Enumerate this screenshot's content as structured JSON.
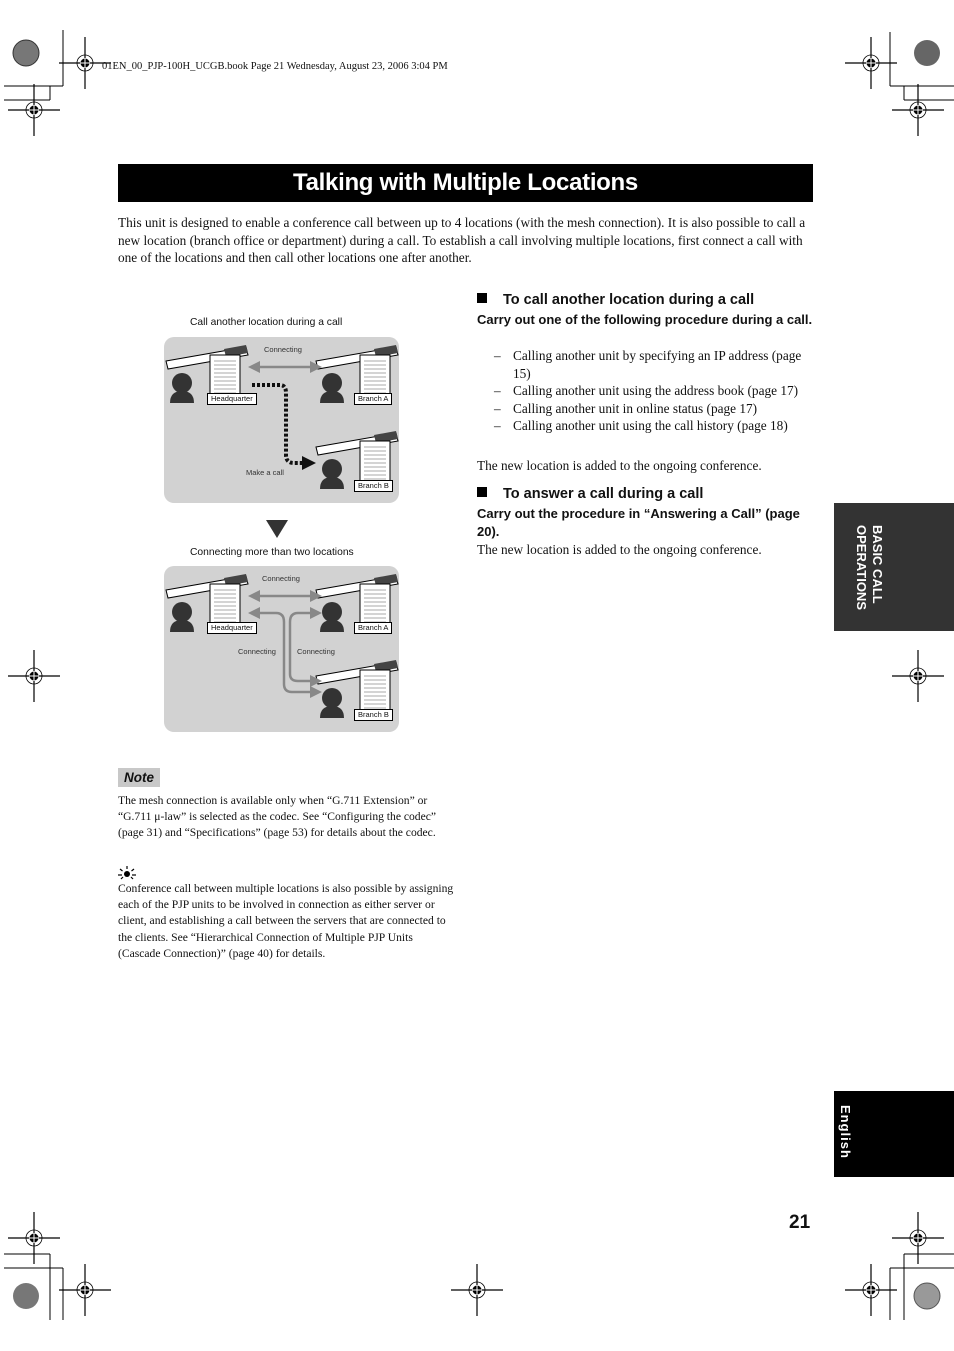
{
  "header": {
    "print_line": "01EN_00_PJP-100H_UCGB.book  Page 21  Wednesday, August 23, 2006  3:04 PM"
  },
  "title": "Talking with Multiple Locations",
  "intro": "This unit is designed to enable a conference call between up to 4 locations (with the mesh connection). It is also possible to call a new location (branch office or department) during a call. To establish a call involving multiple locations, first connect a call with one of the locations and then call other locations one after another.",
  "diagram1": {
    "caption": "Call another location during a call",
    "link_label": "Connecting",
    "call_label": "Make a call",
    "sites": [
      "Headquarter",
      "Branch A",
      "Branch B"
    ]
  },
  "diagram2": {
    "caption": "Connecting more than two locations",
    "link_labels": [
      "Connecting",
      "Connecting",
      "Connecting"
    ],
    "sites": [
      "Headquarter",
      "Branch A",
      "Branch B"
    ]
  },
  "note": {
    "label": "Note",
    "text": "The mesh connection is available only when “G.711 Extension” or “G.711 μ-law” is selected as the codec. See “Configuring the codec” (page 31) and “Specifications” (page 53) for details about the codec.",
    "tip_icon": "lightbulb-icon",
    "tip": "Conference call between multiple locations is also possible by assigning each of the PJP units to be involved in connection as either server or client, and establishing a call between the servers that are connected to the clients. See “Hierarchical Connection of Multiple PJP Units (Cascade Connection)” (page 40) for details."
  },
  "section1": {
    "heading": "To call another location during a call",
    "instruction": "Carry out one of the following procedure during a call.",
    "items": [
      "Calling another unit by specifying an IP address (page 15)",
      "Calling another unit using the address book (page 17)",
      "Calling another unit in online status (page 17)",
      "Calling another unit using the call history (page 18)"
    ],
    "result": "The new location is added to the ongoing conference."
  },
  "section2": {
    "heading": "To answer a call during a call",
    "instruction": "Carry out the procedure in “Answering a Call” (page 20).",
    "result": "The new location is added to the ongoing conference."
  },
  "side_tabs": {
    "chapter": [
      "BASIC CALL",
      "OPERATIONS"
    ],
    "language": "English"
  },
  "page_number": "21"
}
